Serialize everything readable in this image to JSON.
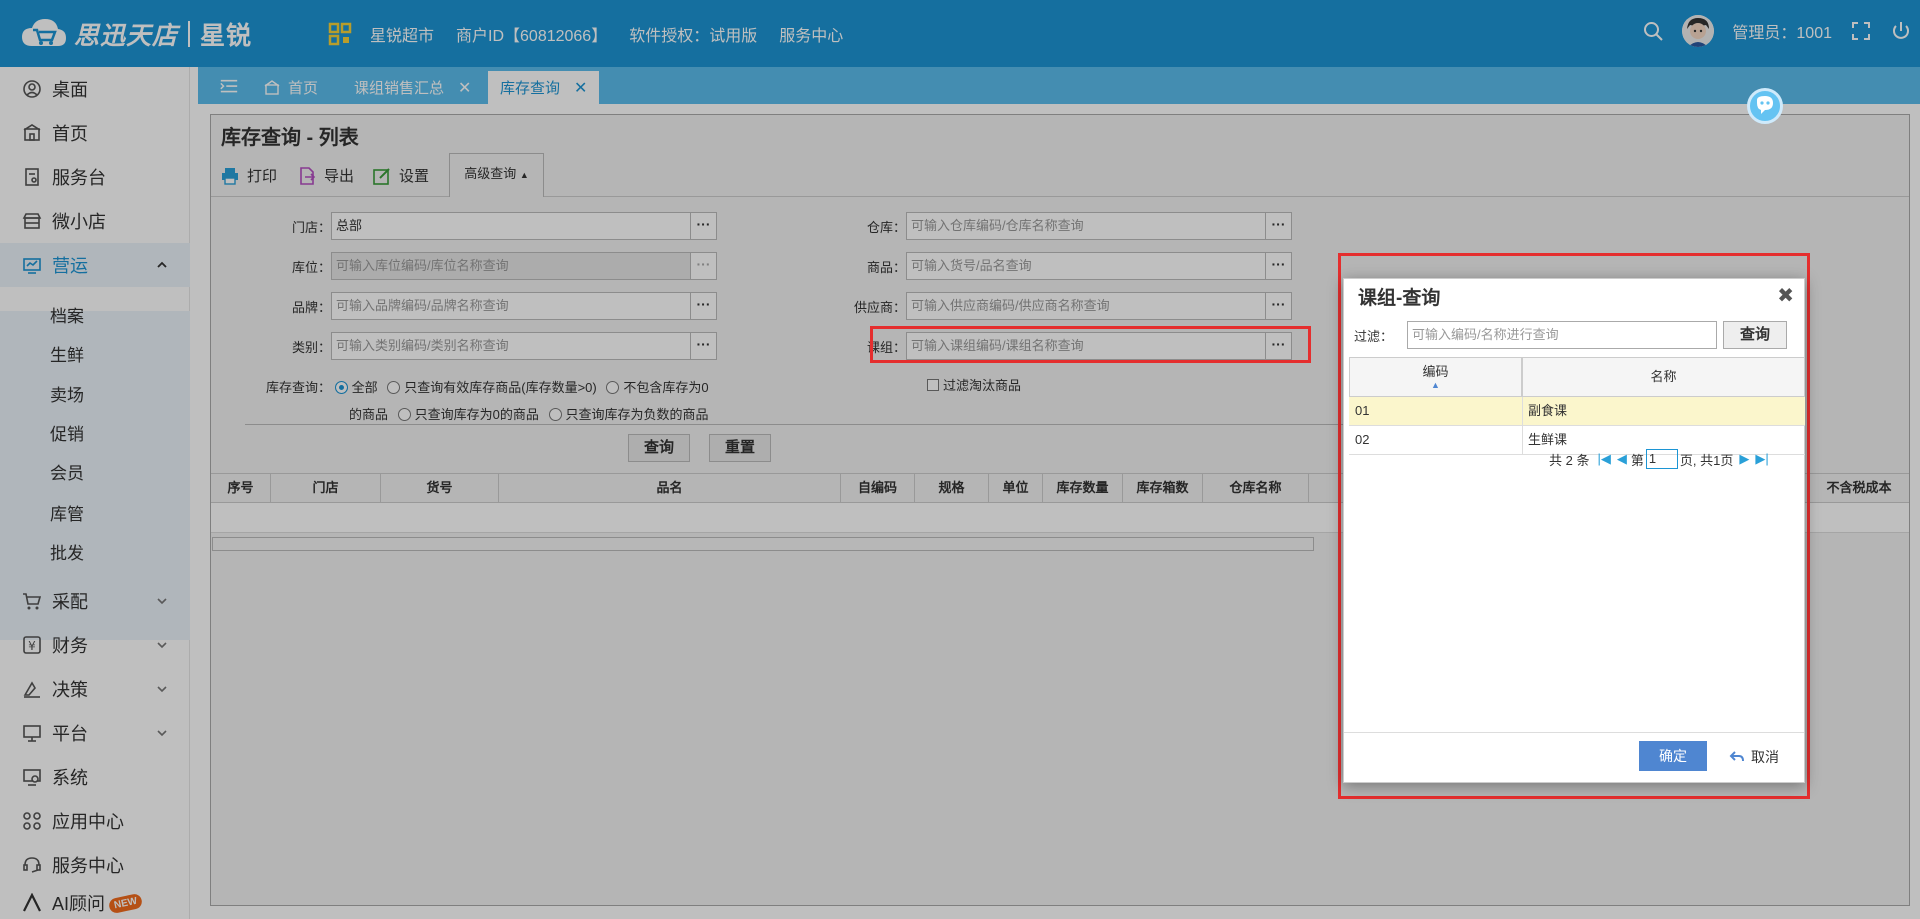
{
  "brand": {
    "name": "思迅",
    "product": "天店",
    "edition": "星锐"
  },
  "topnav": {
    "store": "星锐超市",
    "merchant": "商户ID【60812066】",
    "license": "软件授权：试用版",
    "service": "服务中心"
  },
  "user": {
    "label": "管理员：1001"
  },
  "sidebar": {
    "items": [
      {
        "label": "桌面",
        "icon": "dashboard-icon"
      },
      {
        "label": "首页",
        "icon": "home-icon"
      },
      {
        "label": "服务台",
        "icon": "service-desk-icon"
      },
      {
        "label": "微小店",
        "icon": "shop-icon"
      },
      {
        "label": "营运",
        "icon": "operations-icon"
      },
      {
        "label": "采配",
        "icon": "cart-icon"
      },
      {
        "label": "财务",
        "icon": "finance-icon"
      },
      {
        "label": "决策",
        "icon": "decision-icon"
      },
      {
        "label": "平台",
        "icon": "platform-icon"
      },
      {
        "label": "系统",
        "icon": "system-icon"
      },
      {
        "label": "应用中心",
        "icon": "app-center-icon"
      },
      {
        "label": "服务中心",
        "icon": "service-center-icon"
      },
      {
        "label": "AI顾问",
        "icon": "ai-advisor-icon"
      }
    ],
    "sub_items": [
      "档案",
      "生鲜",
      "卖场",
      "促销",
      "会员",
      "库管",
      "批发"
    ],
    "new_badge": "NEW"
  },
  "tabs": [
    {
      "label": "首页"
    },
    {
      "label": "课组销售汇总"
    },
    {
      "label": "库存查询"
    }
  ],
  "page": {
    "title": "库存查询 - 列表"
  },
  "toolbar": {
    "print": "打印",
    "export": "导出",
    "settings": "设置",
    "advanced": "高级查询"
  },
  "form": {
    "store": {
      "label": "门店：",
      "value": "总部"
    },
    "location": {
      "label": "库位：",
      "placeholder": "可输入库位编码/库位名称查询"
    },
    "brand": {
      "label": "品牌：",
      "placeholder": "可输入品牌编码/品牌名称查询"
    },
    "category": {
      "label": "类别：",
      "placeholder": "可输入类别编码/类别名称查询"
    },
    "warehouse": {
      "label": "仓库：",
      "placeholder": "可输入仓库编码/仓库名称查询"
    },
    "product": {
      "label": "商品：",
      "placeholder": "可输入货号/品名查询"
    },
    "supplier": {
      "label": "供应商：",
      "placeholder": "可输入供应商编码/供应商名称查询"
    },
    "group": {
      "label": "课组：",
      "placeholder": "可输入课组编码/课组名称查询"
    },
    "stock_query": {
      "label": "库存查询：",
      "options": [
        "全部",
        "只查询有效库存商品(库存数量>0)",
        "不包含库存为0",
        "的商品",
        "只查询库存为0的商品",
        "只查询库存为负数的商品"
      ]
    },
    "filter_obsolete": "过滤淘汰商品",
    "query_btn": "查询",
    "reset_btn": "重置"
  },
  "table": {
    "columns": [
      "序号",
      "门店",
      "货号",
      "品名",
      "自编码",
      "规格",
      "单位",
      "库存数量",
      "库存箱数",
      "仓库名称",
      "不含税成本"
    ]
  },
  "dialog": {
    "title": "课组-查询",
    "filter_label": "过滤：",
    "filter_placeholder": "可输入编码/名称进行查询",
    "query_btn": "查询",
    "columns": [
      "编码",
      "名称"
    ],
    "rows": [
      {
        "code": "01",
        "name": "副食课"
      },
      {
        "code": "02",
        "name": "生鲜课"
      }
    ],
    "pager": {
      "total": "共 2 条",
      "page_prefix": "第",
      "page_value": "1",
      "page_suffix": "页, 共1页"
    },
    "ok": "确定",
    "cancel": "取消"
  }
}
